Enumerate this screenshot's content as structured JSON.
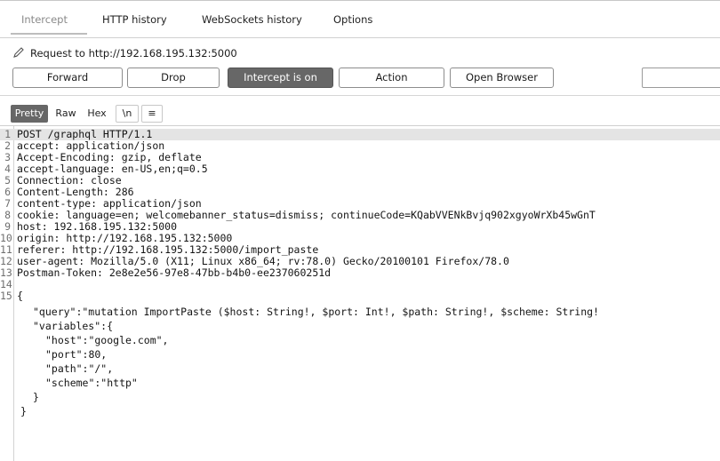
{
  "tabs": [
    "Intercept",
    "HTTP history",
    "WebSockets history",
    "Options"
  ],
  "request_line": {
    "prefix": "Request to ",
    "url": "http://192.168.195.132:5000"
  },
  "toolbar": {
    "forward": "Forward",
    "drop": "Drop",
    "intercept": "Intercept is on",
    "action": "Action",
    "open_browser": "Open Browser"
  },
  "view_tabs": {
    "pretty": "Pretty",
    "raw": "Raw",
    "hex": "Hex",
    "newline": "\\n",
    "menu": "≡"
  },
  "headers": [
    {
      "num": "1",
      "text": "POST /graphql HTTP/1.1"
    },
    {
      "num": "2",
      "text": "accept: application/json"
    },
    {
      "num": "3",
      "text": "Accept-Encoding: gzip, deflate"
    },
    {
      "num": "4",
      "text": "accept-language: en-US,en;q=0.5"
    },
    {
      "num": "5",
      "text": "Connection: close"
    },
    {
      "num": "6",
      "text": "Content-Length: 286"
    },
    {
      "num": "7",
      "text": "content-type: application/json"
    },
    {
      "num": "8",
      "text": "cookie: language=en; welcomebanner_status=dismiss; continueCode=KQabVVENkBvjq902xgyoWrXb45wGnT"
    },
    {
      "num": "9",
      "text": "host: 192.168.195.132:5000"
    },
    {
      "num": "10",
      "text": "origin: http://192.168.195.132:5000"
    },
    {
      "num": "11",
      "text": "referer: http://192.168.195.132:5000/import_paste"
    },
    {
      "num": "12",
      "text": "user-agent: Mozilla/5.0 (X11; Linux x86_64; rv:78.0) Gecko/20100101 Firefox/78.0"
    },
    {
      "num": "13",
      "text": "Postman-Token: 2e8e2e56-97e8-47bb-b4b0-ee237060251d"
    },
    {
      "num": "14",
      "text": ""
    },
    {
      "num": "15",
      "text": "{"
    }
  ],
  "body": [
    "\"query\":\"mutation ImportPaste ($host: String!, $port: Int!, $path: String!, $scheme: String!",
    "\"variables\":{",
    "\"host\":\"google.com\",",
    "\"port\":80,",
    "\"path\":\"/\",",
    "\"scheme\":\"http\"",
    "}",
    "}"
  ]
}
